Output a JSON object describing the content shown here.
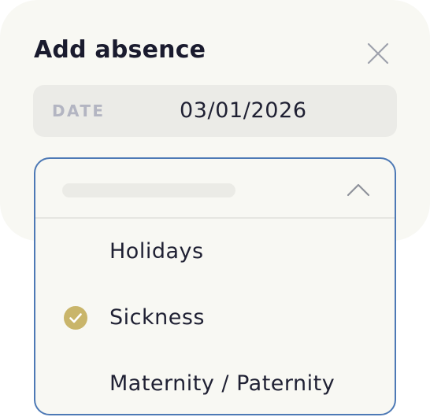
{
  "modal": {
    "title": "Add absence",
    "close_icon": "close-icon"
  },
  "date_field": {
    "label": "DATE",
    "value": "03/01/2026"
  },
  "dropdown": {
    "expanded": true,
    "chevron_icon": "chevron-up-icon",
    "selected": "Sickness",
    "options": [
      {
        "label": "Holidays",
        "selected": false
      },
      {
        "label": "Sickness",
        "selected": true,
        "icon": "check-circle-icon"
      },
      {
        "label": "Maternity / Paternity",
        "selected": false
      }
    ]
  },
  "colors": {
    "modal_background": "#f8f8f3",
    "field_background": "#ebebe7",
    "dropdown_border": "#4d79b5",
    "check_color": "#c9b56a",
    "text_primary": "#1f2033",
    "label_muted": "#b3b5c2"
  }
}
